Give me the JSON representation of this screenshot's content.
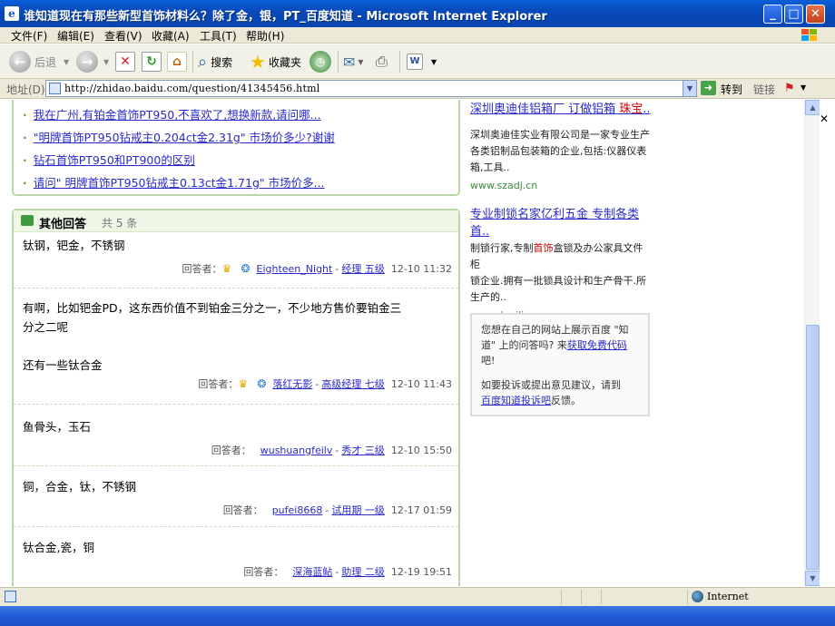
{
  "window": {
    "title": "谁知道现在有那些新型首饰材料么？除了金，银，PT_百度知道 - Microsoft Internet Explorer",
    "min": "_",
    "max": "□",
    "close": "✕"
  },
  "menu": [
    "文件(F)",
    "编辑(E)",
    "查看(V)",
    "收藏(A)",
    "工具(T)",
    "帮助(H)"
  ],
  "toolbar": {
    "back": "后退",
    "search": "搜索",
    "favorites": "收藏夹"
  },
  "address": {
    "label": "地址(D)",
    "url": "http://zhidao.baidu.com/question/41345456.html",
    "go": "转到",
    "links": "链接"
  },
  "related_questions": [
    "我在广州,有铂金首饰PT950,不喜欢了,想换新款,请问哪...",
    "\"明牌首饰PT950钻戒主0.204ct金2.31g\" 市场价多少?谢谢",
    "钻石首饰PT950和PT900的区别",
    "请问\" 明牌首饰PT950钻戒主0.13ct金1.71g\" 市场价多..."
  ],
  "other_answers": {
    "title": "其他回答",
    "count": "共 5 条",
    "answerer_label": "回答者：",
    "items": [
      {
        "text": [
          "钛钢，钯金，不锈钢"
        ],
        "user": "Eighteen_Night",
        "rank": "经理 五级",
        "time": "12-10 11:32",
        "icons": true
      },
      {
        "text": [
          "有啊，比如钯金PD，这东西价值不到铂金三分之一，不少地方售价要铂金三",
          "分之二呢",
          "",
          "还有一些钛合金"
        ],
        "user": "落红无影",
        "rank": "高级经理 七级",
        "time": "12-10 11:43",
        "icons": true
      },
      {
        "text": [
          "鱼骨头，玉石"
        ],
        "user": "wushuangfeilv",
        "rank": "秀才 三级",
        "time": "12-10 15:50",
        "icons": false
      },
      {
        "text": [
          "铜，合金，钛，不锈钢"
        ],
        "user": "pufei8668",
        "rank": "试用期 一级",
        "time": "12-17 01:59",
        "icons": false
      },
      {
        "text": [
          "钛合金,瓷，铜"
        ],
        "user": "深海蓝鲇",
        "rank": "助理 二级",
        "time": "12-19 19:51",
        "icons": false
      }
    ]
  },
  "ads": [
    {
      "title_a": "深圳奥迪佳铝箱厂 订做铝箱 ",
      "title_red": "珠宝",
      "title_b": "..",
      "body": [
        "深圳奥迪佳实业有限公司是一家专业生产",
        "各类铝制品包装箱的企业,包括:仪器仪表",
        "箱,工具.."
      ],
      "url": "www.szadj.cn"
    },
    {
      "title_a": "专业制锁名家亿利五金 专制各类",
      "title_b": "首..",
      "body_pre": "制锁行家,专制",
      "body_red": "首饰",
      "body_post": "盒锁及办公家具文件柜",
      "body": [
        "锁企业.拥有一批锁具设计和生产骨干.所",
        "生产的.."
      ],
      "url": "www.dgyili.com"
    }
  ],
  "promo": {
    "p1_a": "您想在自己的网站上展示百度 \"知",
    "p1_b": "道\" 上的问答吗? 来",
    "p1_link": "获取免费代码",
    "p1_c": "吧!",
    "p2_a": "如要投诉或提出意见建议，请到",
    "p2_link": "百度知道投诉吧",
    "p2_c": "反馈。"
  },
  "status": {
    "zone": "Internet"
  },
  "scroll": {
    "up": "▲",
    "down": "▼"
  },
  "outer_close": "✕"
}
